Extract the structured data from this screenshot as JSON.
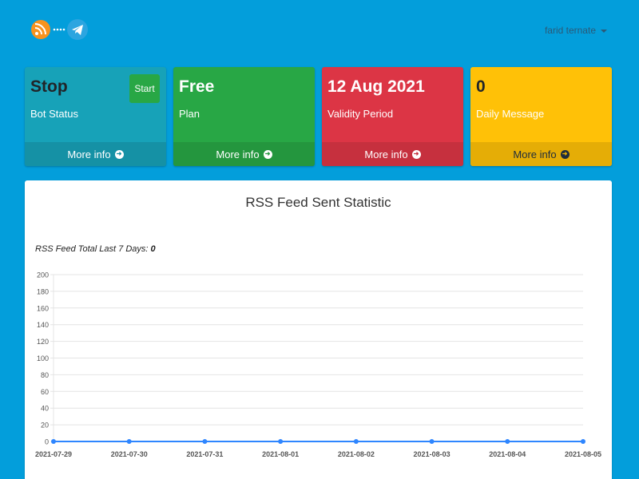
{
  "header": {
    "logo_icon": "rss-telegram-logo",
    "user_name": "farid ternate"
  },
  "boxes": [
    {
      "value": "Stop",
      "label": "Bot Status",
      "footer": "More info",
      "action_label": "Start"
    },
    {
      "value": "Free",
      "label": "Plan",
      "footer": "More info"
    },
    {
      "value": "12 Aug 2021",
      "label": "Validity Period",
      "footer": "More info"
    },
    {
      "value": "0",
      "label": "Daily Message",
      "footer": "More info"
    }
  ],
  "card": {
    "title": "RSS Feed Sent Statistic",
    "total_label": "RSS Feed Total Last 7 Days:",
    "total_value": "0"
  },
  "colors": {
    "background": "#039edb",
    "info": "#17a2b8",
    "success": "#28a745",
    "danger": "#dc3545",
    "warning": "#ffc107",
    "line": "#2f86ff"
  },
  "chart_data": {
    "type": "line",
    "x": [
      "2021-07-29",
      "2021-07-30",
      "2021-07-31",
      "2021-08-01",
      "2021-08-02",
      "2021-08-03",
      "2021-08-04",
      "2021-08-05"
    ],
    "series": [
      {
        "values": [
          0,
          0,
          0,
          0,
          0,
          0,
          0,
          0
        ]
      }
    ],
    "yticks": [
      0,
      20,
      40,
      60,
      80,
      100,
      120,
      140,
      160,
      180,
      200
    ],
    "ylim": [
      0,
      200
    ],
    "grid": true
  }
}
